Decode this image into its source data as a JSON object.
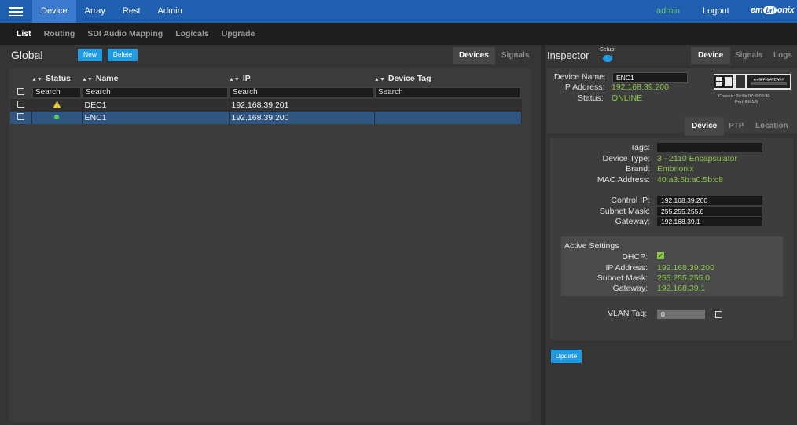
{
  "topnav": {
    "items": [
      "Device",
      "Array",
      "Rest",
      "Admin"
    ],
    "user": "admin",
    "logout": "Logout",
    "logo_left": "em",
    "logo_mid": "bri",
    "logo_right": "onix"
  },
  "subnav": {
    "items": [
      "List",
      "Routing",
      "SDI Audio Mapping",
      "Logicals",
      "Upgrade"
    ]
  },
  "global": {
    "title": "Global",
    "new_button": "New",
    "delete_button": "Delete",
    "tabs": [
      "Devices",
      "Signals"
    ]
  },
  "table": {
    "headers": [
      "Status",
      "Name",
      "IP",
      "Device Tag"
    ],
    "search_placeholder": "Search",
    "rows": [
      {
        "name": "DEC1",
        "ip": "192.168.39.201",
        "tag": ""
      },
      {
        "name": "ENC1",
        "ip": "192.168.39.200",
        "tag": ""
      }
    ]
  },
  "inspector": {
    "title": "Inspector",
    "setup_label": "Setup",
    "tabs": [
      "Device",
      "Signals",
      "Logs"
    ],
    "device_name_label": "Device Name:",
    "device_name": "ENC1",
    "ip_label": "IP Address:",
    "ip": "192.168.39.200",
    "status_label": "Status:",
    "status": "ONLINE",
    "device_image_label": "emSFP-GATEWAY",
    "chassis": "Chassis: 2d:6b:07:f6:03:80",
    "port": "Port: Eth1/9",
    "subtabs": [
      "Device",
      "PTP",
      "Location"
    ]
  },
  "details": {
    "tags_label": "Tags:",
    "tags_value": "",
    "device_type_label": "Device Type:",
    "device_type": "3 - 2110 Encapsulator",
    "brand_label": "Brand:",
    "brand": "Embrionix",
    "mac_label": "MAC Address:",
    "mac": "40:a3:6b:a0:5b:c8",
    "control_ip_label": "Control IP:",
    "control_ip": "192.168.39.200",
    "subnet_label": "Subnet Mask:",
    "subnet": "255.255.255.0",
    "gateway_label": "Gateway:",
    "gateway": "192.168.39.1",
    "active_title": "Active Settings",
    "dhcp_label": "DHCP:",
    "active_ip_label": "IP Address:",
    "active_ip": "192.168.39.200",
    "active_subnet_label": "Subnet Mask:",
    "active_subnet": "255.255.255.0",
    "active_gateway_label": "Gateway:",
    "active_gateway": "192.168.39.1",
    "vlan_label": "VLAN Tag:",
    "vlan_value": "0",
    "update_button": "Update"
  }
}
